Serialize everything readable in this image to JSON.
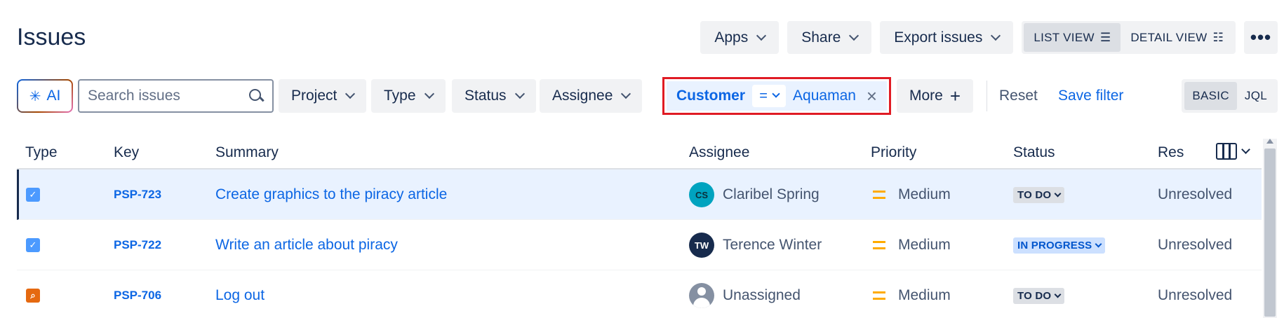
{
  "page": {
    "title": "Issues"
  },
  "toolbar": {
    "apps_label": "Apps",
    "share_label": "Share",
    "export_label": "Export issues",
    "list_view_label": "LIST VIEW",
    "detail_view_label": "DETAIL VIEW",
    "more_label": "•••"
  },
  "filters": {
    "ai_label": "AI",
    "search_placeholder": "Search issues",
    "project_label": "Project",
    "type_label": "Type",
    "status_label": "Status",
    "assignee_label": "Assignee",
    "customer": {
      "label": "Customer",
      "operator": "=",
      "value": "Aquaman"
    },
    "more_label": "More",
    "reset_label": "Reset",
    "save_label": "Save filter",
    "basic_label": "BASIC",
    "jql_label": "JQL"
  },
  "table": {
    "headers": {
      "type": "Type",
      "key": "Key",
      "summary": "Summary",
      "assignee": "Assignee",
      "priority": "Priority",
      "status": "Status",
      "resolution": "Res"
    },
    "rows": [
      {
        "type_icon": "task-icon",
        "key": "PSP-723",
        "summary": "Create graphics to the piracy article",
        "avatar": "CS",
        "assignee": "Claribel Spring",
        "priority": "Medium",
        "status": "TO DO",
        "resolution": "Unresolved"
      },
      {
        "type_icon": "task-icon",
        "key": "PSP-722",
        "summary": "Write an article about piracy",
        "avatar": "TW",
        "assignee": "Terence Winter",
        "priority": "Medium",
        "status": "IN PROGRESS",
        "resolution": "Unresolved"
      },
      {
        "type_icon": "bug-icon",
        "key": "PSP-706",
        "summary": "Log out",
        "avatar": "",
        "assignee": "Unassigned",
        "priority": "Medium",
        "status": "TO DO",
        "resolution": "Unresolved"
      }
    ]
  },
  "colors": {
    "accent": "#0c66e4",
    "highlight_border": "#e01b24",
    "priority_medium": "#ffab00"
  }
}
